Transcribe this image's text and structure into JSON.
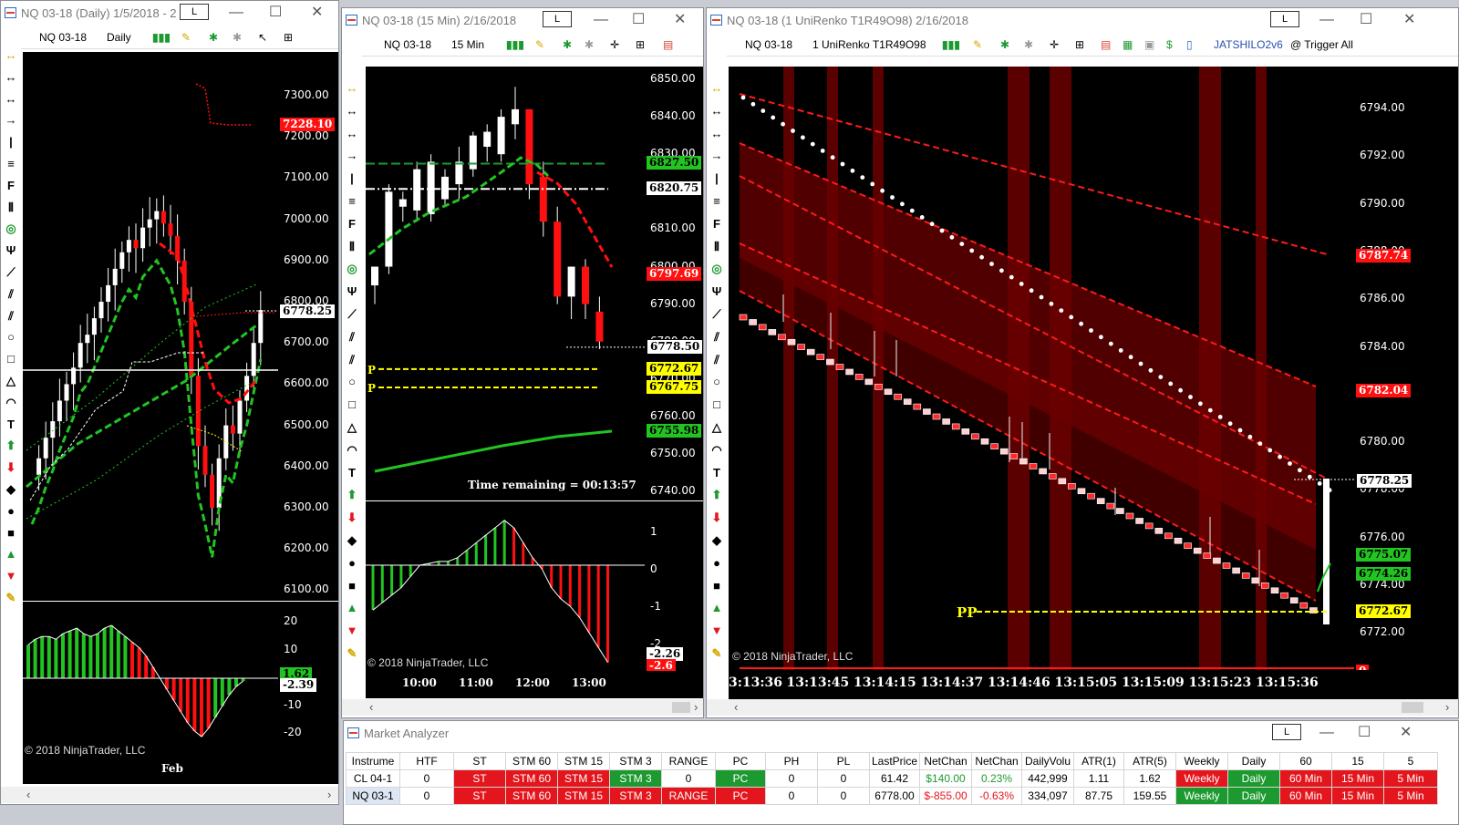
{
  "window1": {
    "title": "NQ 03-18 (Daily)  1/5/2018 - 2",
    "instrument": "NQ 03-18",
    "interval": "Daily",
    "yticks": [
      "7300.00",
      "7200.00",
      "7100.00",
      "7000.00",
      "6900.00",
      "6800.00",
      "6700.00",
      "6600.00",
      "6500.00",
      "6400.00",
      "6300.00",
      "6200.00",
      "6100.00"
    ],
    "tags": {
      "red": "7228.10",
      "white": "6778.25"
    },
    "osc_ticks": [
      "20",
      "10",
      "0",
      "-10",
      "-20"
    ],
    "osc_tags": {
      "green": "1.62",
      "white": "-2.39"
    },
    "xlabel": "Feb",
    "copyright": "© 2018 NinjaTrader, LLC"
  },
  "window2": {
    "title": "NQ 03-18 (15 Min)  2/16/2018",
    "instrument": "NQ 03-18",
    "interval": "15 Min",
    "yticks": [
      "6850.00",
      "6840.00",
      "6830.00",
      "6820.00",
      "6810.00",
      "6800.00",
      "6790.00",
      "6780.00",
      "6770.00",
      "6760.00",
      "6750.00",
      "6740.00"
    ],
    "tags": {
      "green_top": "6827.50",
      "white_top": "6820.75",
      "red": "6797.69",
      "last": "6778.50",
      "yellow1": "6772.67",
      "yellow2": "6767.75",
      "green_bottom": "6755.98"
    },
    "p_label": "P",
    "time_remaining": "Time remaining = 00:13:57",
    "osc_ticks": [
      "1",
      "0",
      "-1",
      "-2"
    ],
    "osc_tags": {
      "white": "-2.26",
      "red": "-2.6"
    },
    "xlabels": [
      "10:00",
      "11:00",
      "12:00",
      "13:00"
    ],
    "copyright": "© 2018 NinjaTrader, LLC"
  },
  "window3": {
    "title": "NQ 03-18 (1 UniRenko T1R49O98)  2/16/2018",
    "instrument": "NQ 03-18",
    "interval": "1 UniRenko T1R49O98",
    "strategy": "JATSHILO2v6",
    "trigger": "@ Trigger All",
    "yticks": [
      "6794.00",
      "6792.00",
      "6790.00",
      "6788.00",
      "6786.00",
      "6784.00",
      "6782.00",
      "6780.00",
      "6778.00",
      "6776.00",
      "6774.00",
      "6772.00"
    ],
    "tags": {
      "red1": "6787.74",
      "red2": "6782.04",
      "last": "6778.25",
      "green1": "6775.07",
      "green2": "6774.26",
      "yellow": "6772.67",
      "zero": "0"
    },
    "pp_label": "PP",
    "xlabels": [
      "3:13:36",
      "13:13:45",
      "13:14:15",
      "13:14:37",
      "13:14:46",
      "13:15:05",
      "13:15:09",
      "13:15:23",
      "13:15:36"
    ],
    "copyright": "© 2018 NinjaTrader, LLC"
  },
  "market_analyzer": {
    "title": "Market Analyzer",
    "columns": [
      "Instrume",
      "HTF",
      "ST",
      "STM 60",
      "STM 15",
      "STM 3",
      "RANGE",
      "PC",
      "PH",
      "PL",
      "LastPrice",
      "NetChan",
      "NetChan",
      "DailyVolu",
      "ATR(1)",
      "ATR(5)",
      "Weekly",
      "Daily",
      "60",
      "15",
      "5"
    ],
    "rows": [
      [
        "CL 04-1",
        "0",
        "ST",
        "STM 60",
        "STM 15",
        "STM 3",
        "0",
        "PC",
        "0",
        "0",
        "61.42",
        "$140.00",
        "0.23%",
        "442,999",
        "1.11",
        "1.62",
        "Weekly",
        "Daily",
        "60 Min",
        "15 Min",
        "5 Min"
      ],
      [
        "NQ 03-1",
        "0",
        "ST",
        "STM 60",
        "STM 15",
        "STM 3",
        "RANGE",
        "PC",
        "0",
        "0",
        "6778.00",
        "$-855.00",
        "-0.63%",
        "334,097",
        "87.75",
        "159.55",
        "Weekly",
        "Daily",
        "60 Min",
        "15 Min",
        "5 Min"
      ]
    ],
    "row_colors": [
      [
        "",
        "",
        "red",
        "red",
        "red",
        "grn",
        "",
        "grn",
        "",
        "",
        "",
        "",
        "",
        "",
        "",
        "",
        "red",
        "grn",
        "red",
        "red",
        "red"
      ],
      [
        "",
        "",
        "red",
        "red",
        "red",
        "red",
        "red",
        "red",
        "",
        "",
        "",
        "",
        "",
        "",
        "",
        "",
        "grn",
        "grn",
        "red",
        "red",
        "red"
      ]
    ],
    "text_colors": [
      [
        "",
        "",
        "",
        "",
        "",
        "",
        "",
        "",
        "",
        "",
        "",
        "#1c9a30",
        "#1c9a30",
        "",
        "",
        "",
        "",
        "",
        "",
        "",
        ""
      ],
      [
        "",
        "",
        "",
        "",
        "",
        "",
        "",
        "",
        "",
        "",
        "",
        "#e3161d",
        "#e3161d",
        "",
        "",
        "",
        "",
        "",
        "",
        "",
        ""
      ]
    ]
  },
  "colors": {
    "bull": "#ffffff",
    "bear": "#ff1010",
    "accent_green": "#22c422",
    "accent_yellow": "#ffff00",
    "band": "#6b0000"
  }
}
